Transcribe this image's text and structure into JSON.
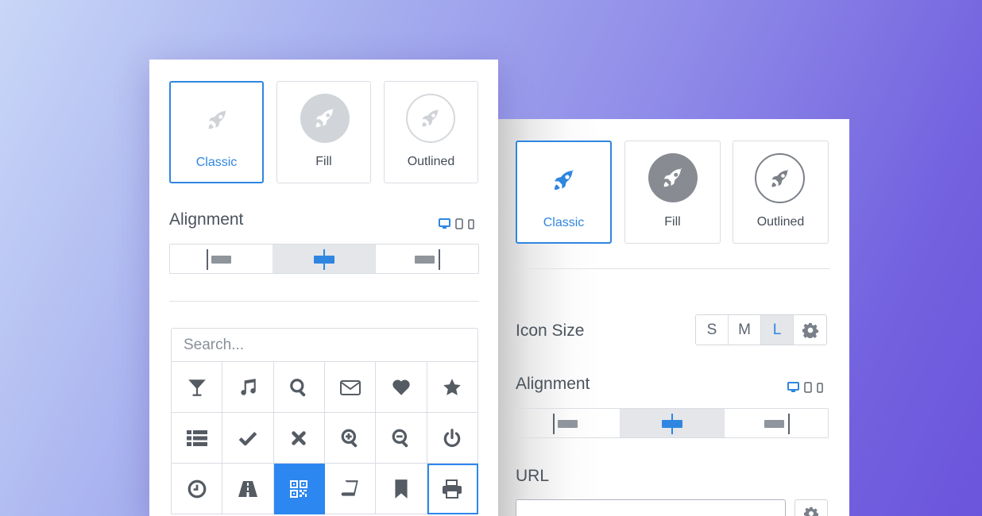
{
  "left_panel": {
    "styles": [
      {
        "label": "Classic",
        "active": true
      },
      {
        "label": "Fill",
        "active": false
      },
      {
        "label": "Outlined",
        "active": false
      }
    ],
    "alignment": {
      "title": "Alignment",
      "options": [
        "left",
        "center",
        "right"
      ],
      "selected": "center"
    },
    "devices": [
      "desktop-icon",
      "tablet-icon",
      "mobile-icon"
    ],
    "search": {
      "placeholder": "Search..."
    },
    "icon_grid": [
      "cocktail-icon",
      "music-icon",
      "search-icon",
      "envelope-icon",
      "heart-icon",
      "star-icon",
      "list-icon",
      "check-icon",
      "times-icon",
      "zoom-in-icon",
      "zoom-out-icon",
      "power-icon",
      "clock-icon",
      "road-icon",
      "qrcode-icon",
      "book-icon",
      "bookmark-icon",
      "print-icon"
    ],
    "selected_icon": "qrcode-icon",
    "focused_icon": "print-icon"
  },
  "right_panel": {
    "styles": [
      {
        "label": "Classic",
        "active": true
      },
      {
        "label": "Fill",
        "active": false
      },
      {
        "label": "Outlined",
        "active": false
      }
    ],
    "icon_size": {
      "title": "Icon Size",
      "options": [
        "S",
        "M",
        "L"
      ],
      "selected": "L"
    },
    "alignment": {
      "title": "Alignment",
      "options": [
        "left",
        "center",
        "right"
      ],
      "selected": "center"
    },
    "url": {
      "title": "URL",
      "value": ""
    }
  },
  "colors": {
    "accent": "#2f86e0",
    "muted_icon": "#d0d3d7",
    "dark_icon": "#5a6069"
  }
}
